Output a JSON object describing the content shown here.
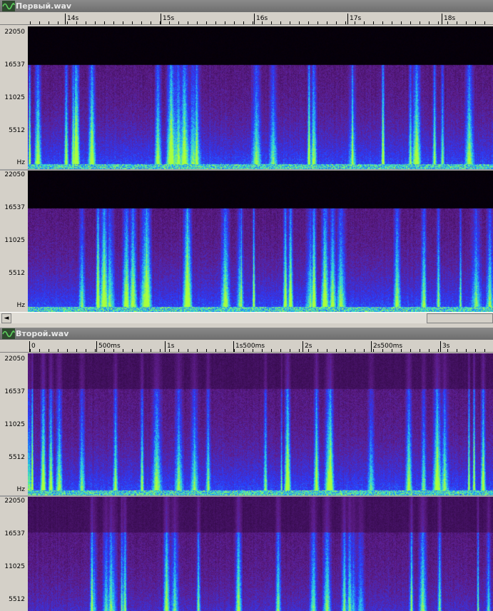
{
  "windows": [
    {
      "title": "Первый.wav",
      "time_ticks": [
        "14s",
        "15s",
        "16s",
        "17s",
        "18s"
      ],
      "channels": [
        {
          "freq_labels": [
            "22050",
            "16537",
            "11025",
            "5512",
            "Hz"
          ]
        },
        {
          "freq_labels": [
            "22050",
            "16537",
            "11025",
            "5512",
            "Hz"
          ]
        }
      ]
    },
    {
      "title": "Второй.wav",
      "time_ticks": [
        "0",
        "500ms",
        "1s",
        "1s500ms",
        "2s",
        "2s500ms",
        "3s"
      ],
      "channels": [
        {
          "freq_labels": [
            "22050",
            "16537",
            "11025",
            "5512",
            "Hz"
          ]
        },
        {
          "freq_labels": [
            "22050",
            "16537",
            "11025",
            "5512"
          ]
        }
      ]
    }
  ],
  "scrollbar": {
    "left_arrow": "◄"
  },
  "colors": {
    "spectrogram_bg": "#1a0520",
    "cutoff_band": "#000000",
    "purple": "#5a1a7a",
    "blue": "#2a3aff",
    "cyan": "#30e0d0",
    "green": "#a0ff30"
  }
}
